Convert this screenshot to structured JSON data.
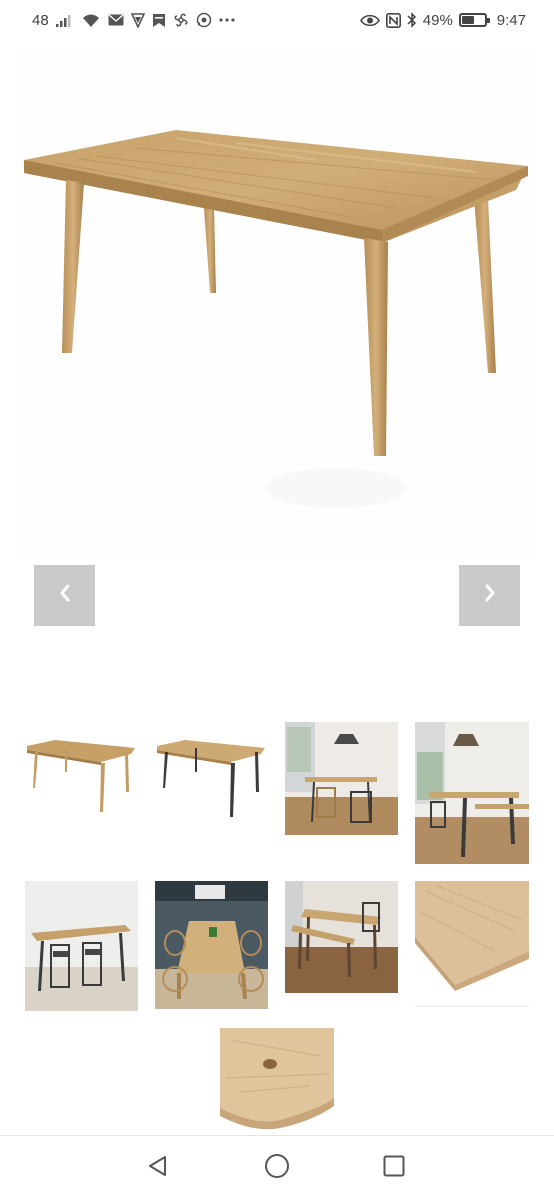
{
  "status_bar": {
    "notif_count": "48",
    "battery_percent": "49%",
    "time": "9:47",
    "battery_level": 0.49,
    "icons": [
      "signal-icon",
      "wifi-icon",
      "mail-icon",
      "vpn-icon",
      "bookmark-icon",
      "pinwheel-icon",
      "whatsapp-icon",
      "more-icon",
      "eye-icon",
      "nfc-icon",
      "bluetooth-icon",
      "battery-icon"
    ]
  },
  "gallery": {
    "main_image": "oak-table-light-legs",
    "prev_icon": "chevron-left-icon",
    "next_icon": "chevron-right-icon",
    "thumbnails": [
      "oak-table-light-legs",
      "oak-table-dark-legs",
      "dining-room-light-chairs",
      "dining-room-bench",
      "table-with-dark-chairs",
      "kitchen-table-wishbone-chairs",
      "table-with-bench-wood-floor",
      "tabletop-corner-detail",
      "live-edge-knot-detail"
    ]
  },
  "nav": {
    "icons": [
      "back-icon",
      "home-icon",
      "recents-icon"
    ]
  },
  "colors": {
    "oak": "#c9a46e",
    "oak_dark": "#a88350",
    "arrow_bg": "#c9c9c9",
    "leg_dark": "#3b3b3b"
  }
}
